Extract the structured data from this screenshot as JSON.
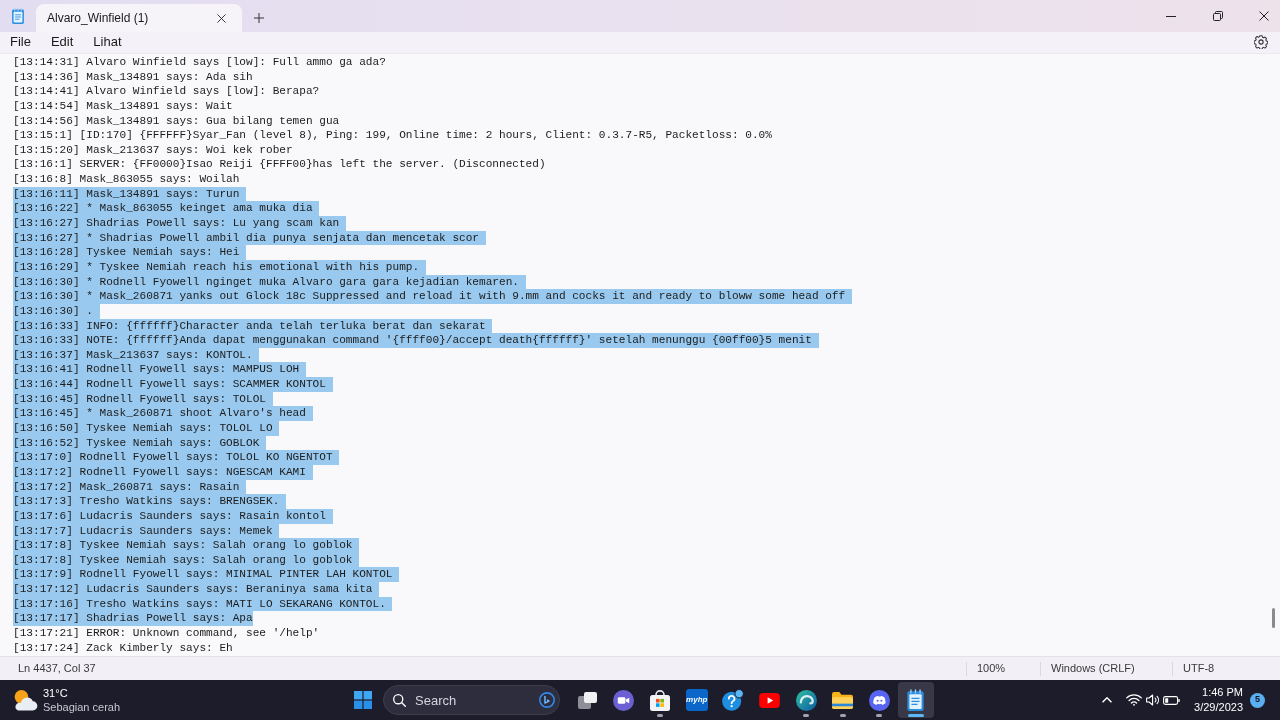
{
  "title_bar": {
    "tabs": [
      {
        "label": "Alvaro_Winfield (1)",
        "selected": true
      }
    ]
  },
  "menu": [
    "File",
    "Edit",
    "Lihat"
  ],
  "lines": [
    {
      "text": "[13:14:31] Alvaro Winfield says [low]: Full ammo ga ada?",
      "selected": false
    },
    {
      "text": "[13:14:36] Mask_134891 says: Ada sih",
      "selected": false
    },
    {
      "text": "[13:14:41] Alvaro Winfield says [low]: Berapa?",
      "selected": false
    },
    {
      "text": "[13:14:54] Mask_134891 says: Wait",
      "selected": false
    },
    {
      "text": "[13:14:56] Mask_134891 says: Gua bilang temen gua",
      "selected": false
    },
    {
      "text": "[13:15:1] [ID:170] {FFFFFF}Syar_Fan (level 8), Ping: 199, Online time: 2 hours, Client: 0.3.7-R5, Packetloss: 0.0%",
      "selected": false
    },
    {
      "text": "[13:15:20] Mask_213637 says: Woi kek rober",
      "selected": false
    },
    {
      "text": "[13:16:1] SERVER: {FF0000}Isao Reiji {FFFF00}has left the server. (Disconnected)",
      "selected": false
    },
    {
      "text": "[13:16:8] Mask_863055 says: Woilah",
      "selected": false
    },
    {
      "text": "[13:16:11] Mask_134891 says: Turun",
      "selected": true
    },
    {
      "text": "[13:16:22] * Mask_863055 keinget ama muka dia",
      "selected": true
    },
    {
      "text": "[13:16:27] Shadrias Powell says: Lu yang scam kan",
      "selected": true
    },
    {
      "text": "[13:16:27] * Shadrias Powell ambil dia punya senjata dan mencetak scor",
      "selected": true
    },
    {
      "text": "[13:16:28] Tyskee Nemiah says: Hei",
      "selected": true
    },
    {
      "text": "[13:16:29] * Tyskee Nemiah reach his emotional with his pump.",
      "selected": true
    },
    {
      "text": "[13:16:30] * Rodnell Fyowell nginget muka Alvaro gara gara kejadian kemaren.",
      "selected": true
    },
    {
      "text": "[13:16:30] * Mask_260871 yanks out Glock 18c Suppressed and reload it with 9.mm and cocks it and ready to bloww some head off",
      "selected": true
    },
    {
      "text": "[13:16:30] .",
      "selected": true
    },
    {
      "text": "[13:16:33] INFO: {ffffff}Character anda telah terluka berat dan sekarat",
      "selected": true
    },
    {
      "text": "[13:16:33] NOTE: {ffffff}Anda dapat menggunakan command '{ffff00}/accept death{ffffff}' setelah menunggu {00ff00}5 menit",
      "selected": true
    },
    {
      "text": "[13:16:37] Mask_213637 says: KONTOL.",
      "selected": true
    },
    {
      "text": "[13:16:41] Rodnell Fyowell says: MAMPUS LOH",
      "selected": true
    },
    {
      "text": "[13:16:44] Rodnell Fyowell says: SCAMMER KONTOL",
      "selected": true
    },
    {
      "text": "[13:16:45] Rodnell Fyowell says: TOLOL",
      "selected": true
    },
    {
      "text": "[13:16:45] * Mask_260871 shoot Alvaro's head",
      "selected": true
    },
    {
      "text": "[13:16:50] Tyskee Nemiah says: TOLOL LO",
      "selected": true
    },
    {
      "text": "[13:16:52] Tyskee Nemiah says: GOBLOK",
      "selected": true
    },
    {
      "text": "[13:17:0] Rodnell Fyowell says: TOLOL KO NGENTOT",
      "selected": true
    },
    {
      "text": "[13:17:2] Rodnell Fyowell says: NGESCAM KAMI",
      "selected": true
    },
    {
      "text": "[13:17:2] Mask_260871 says: Rasain",
      "selected": true
    },
    {
      "text": "[13:17:3] Tresho Watkins says: BRENGSEK.",
      "selected": true
    },
    {
      "text": "[13:17:6] Ludacris Saunders says: Rasain kontol",
      "selected": true
    },
    {
      "text": "[13:17:7] Ludacris Saunders says: Memek",
      "selected": true
    },
    {
      "text": "[13:17:8] Tyskee Nemiah says: Salah orang lo goblok",
      "selected": true
    },
    {
      "text": "[13:17:8] Tyskee Nemiah says: Salah orang lo goblok",
      "selected": true
    },
    {
      "text": "[13:17:9] Rodnell Fyowell says: MINIMAL PINTER LAH KONTOL",
      "selected": true
    },
    {
      "text": "[13:17:12] Ludacris Saunders says: Beraninya sama kita",
      "selected": true
    },
    {
      "text": "[13:17:16] Tresho Watkins says: MATI LO SEKARANG KONTOL.",
      "selected": true
    },
    {
      "text": "[13:17:17] Shadrias Powell says: Apa",
      "selected": true
    },
    {
      "text": "[13:17:21] ERROR: Unknown command, see '/help'",
      "selected": false
    },
    {
      "text": "[13:17:24] Zack Kimberly says: Eh",
      "selected": false
    }
  ],
  "status_bar": {
    "position": "Ln 4437, Col 37",
    "zoom": "100%",
    "line_ending": "Windows (CRLF)",
    "encoding": "UTF-8"
  },
  "taskbar": {
    "weather": {
      "temperature": "31°C",
      "condition": "Sebagian cerah"
    },
    "search": {
      "placeholder": "Search"
    },
    "apps": [
      {
        "kind": "task-view",
        "running": false,
        "active": false
      },
      {
        "kind": "video-chat",
        "running": false,
        "active": false
      },
      {
        "kind": "store",
        "running": true,
        "active": false
      },
      {
        "kind": "tile",
        "label": "myhp",
        "running": false,
        "active": false
      },
      {
        "kind": "help",
        "running": false,
        "active": false
      },
      {
        "kind": "video",
        "running": false,
        "active": false
      },
      {
        "kind": "browser",
        "running": true,
        "active": false
      },
      {
        "kind": "folder",
        "running": true,
        "active": false
      },
      {
        "kind": "chat",
        "running": true,
        "active": false
      },
      {
        "kind": "notepad",
        "running": true,
        "active": true
      }
    ],
    "clock": {
      "time": "1:46 PM",
      "date": "3/29/2023"
    },
    "notifications": "5"
  }
}
